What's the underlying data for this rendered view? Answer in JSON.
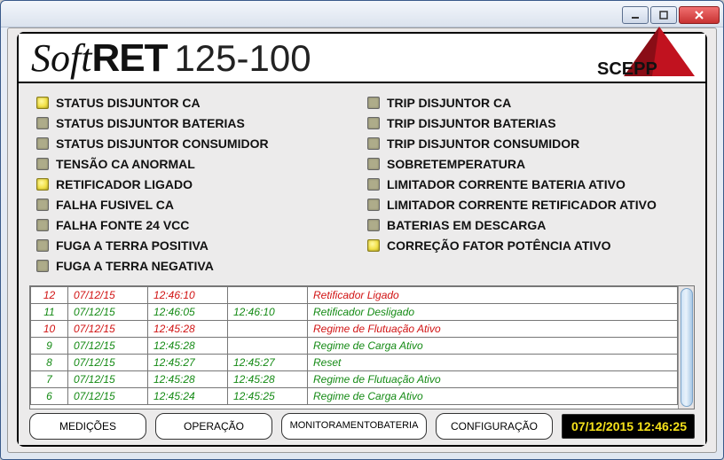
{
  "window": {
    "title": ""
  },
  "app": {
    "title_soft": "Soft",
    "title_ret": "RET",
    "title_model": "125-100",
    "brand": "SCEPP"
  },
  "status_left": [
    {
      "label": "STATUS DISJUNTOR CA",
      "on": true
    },
    {
      "label": "STATUS DISJUNTOR BATERIAS",
      "on": false
    },
    {
      "label": "STATUS DISJUNTOR CONSUMIDOR",
      "on": false
    },
    {
      "label": "TENSÃO CA ANORMAL",
      "on": false
    },
    {
      "label": "RETIFICADOR LIGADO",
      "on": true
    },
    {
      "label": "FALHA FUSIVEL CA",
      "on": false
    },
    {
      "label": "FALHA FONTE 24 VCC",
      "on": false
    },
    {
      "label": "FUGA A TERRA POSITIVA",
      "on": false
    },
    {
      "label": "FUGA A TERRA NEGATIVA",
      "on": false
    }
  ],
  "status_right": [
    {
      "label": "TRIP DISJUNTOR CA",
      "on": false
    },
    {
      "label": "TRIP DISJUNTOR BATERIAS",
      "on": false
    },
    {
      "label": "TRIP DISJUNTOR CONSUMIDOR",
      "on": false
    },
    {
      "label": "SOBRETEMPERATURA",
      "on": false
    },
    {
      "label": "LIMITADOR CORRENTE BATERIA ATIVO",
      "on": false
    },
    {
      "label": "LIMITADOR CORRENTE RETIFICADOR ATIVO",
      "on": false
    },
    {
      "label": "BATERIAS EM DESCARGA",
      "on": false
    },
    {
      "label": "CORREÇÃO FATOR POTÊNCIA ATIVO",
      "on": true
    }
  ],
  "log": [
    {
      "n": "12",
      "date": "07/12/15",
      "t1": "12:46:10",
      "t2": "",
      "msg": "Retificador Ligado",
      "color": "red"
    },
    {
      "n": "11",
      "date": "07/12/15",
      "t1": "12:46:05",
      "t2": "12:46:10",
      "msg": "Retificador Desligado",
      "color": "green"
    },
    {
      "n": "10",
      "date": "07/12/15",
      "t1": "12:45:28",
      "t2": "",
      "msg": "Regime de Flutuação Ativo",
      "color": "red"
    },
    {
      "n": "9",
      "date": "07/12/15",
      "t1": "12:45:28",
      "t2": "",
      "msg": "Regime de Carga Ativo",
      "color": "green"
    },
    {
      "n": "8",
      "date": "07/12/15",
      "t1": "12:45:27",
      "t2": "12:45:27",
      "msg": "Reset",
      "color": "green"
    },
    {
      "n": "7",
      "date": "07/12/15",
      "t1": "12:45:28",
      "t2": "12:45:28",
      "msg": "Regime de Flutuação Ativo",
      "color": "green"
    },
    {
      "n": "6",
      "date": "07/12/15",
      "t1": "12:45:24",
      "t2": "12:45:25",
      "msg": "Regime de Carga Ativo",
      "color": "green"
    }
  ],
  "nav": {
    "b1": "MEDIÇÕES",
    "b2": "OPERAÇÃO",
    "b3": "MONITORAMENTO\nBATERIA",
    "b4": "CONFIGURAÇÃO"
  },
  "clock": "07/12/2015 12:46:25"
}
